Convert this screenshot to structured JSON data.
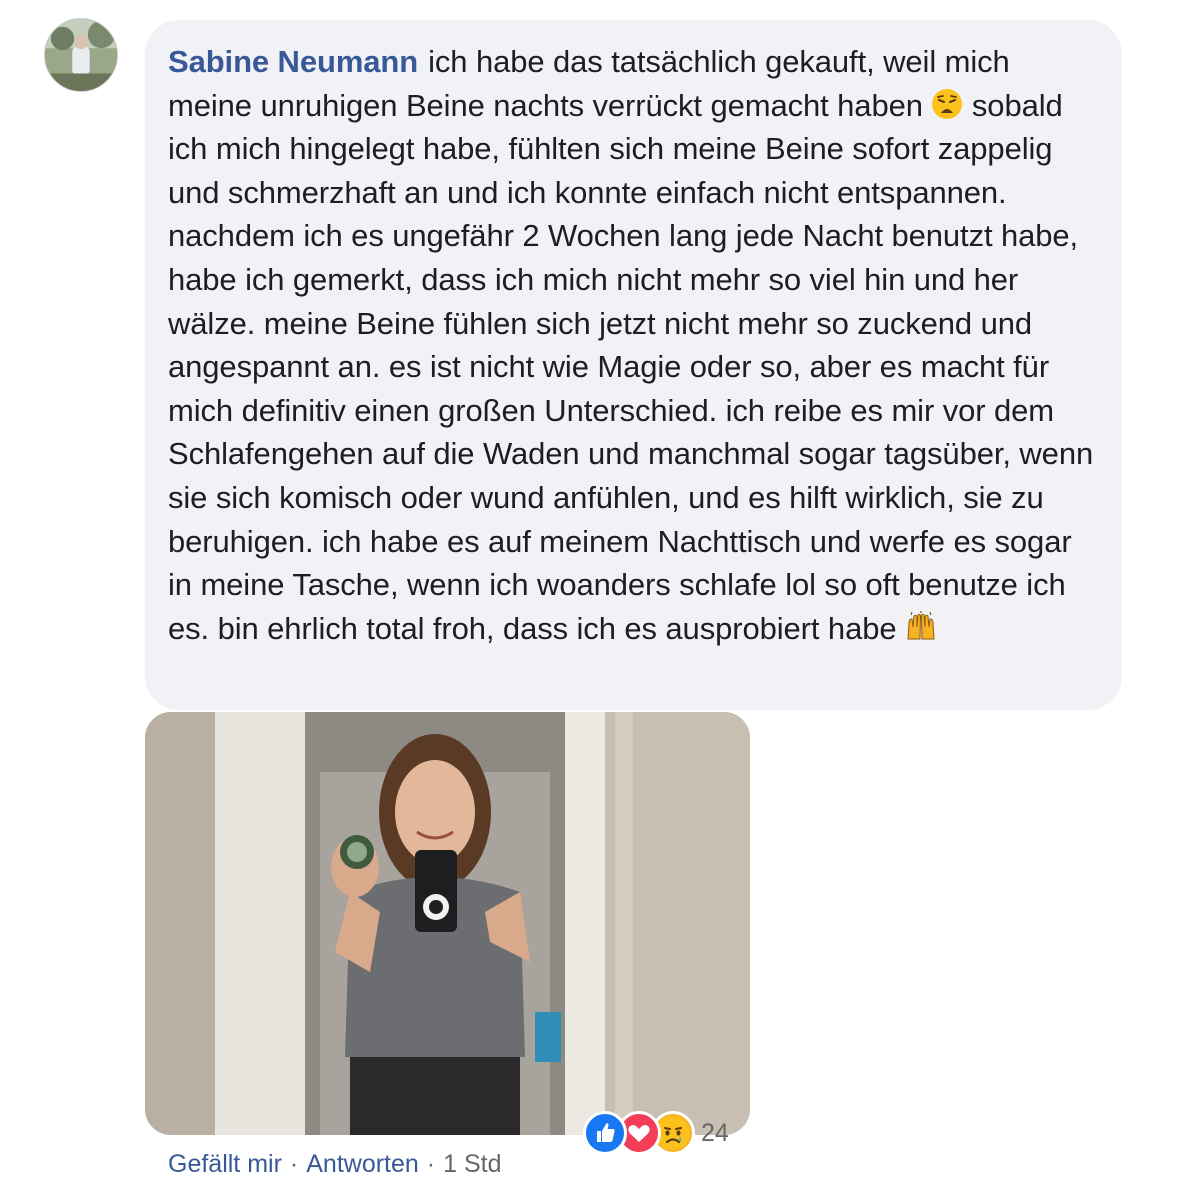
{
  "comment": {
    "author": "Sabine Neumann",
    "text_part1": "ich habe das tatsächlich gekauft, weil mich meine unruhigen Beine nachts verrückt gemacht haben",
    "emoji1": "weary-face",
    "text_part2": "sobald ich mich hingelegt habe, fühlten sich meine Beine sofort zappelig und schmerzhaft an und ich konnte einfach nicht entspannen. nachdem ich es ungefähr 2 Wochen lang jede Nacht benutzt habe, habe ich gemerkt, dass ich mich nicht mehr so viel hin und her wälze. meine Beine fühlen sich jetzt nicht mehr so zuckend und angespannt an. es ist nicht wie Magie oder so, aber es macht für mich definitiv einen großen Unterschied. ich reibe es mir vor dem Schlafengehen auf die Waden und manchmal sogar tagsüber, wenn sie sich komisch oder wund anfühlen, und es hilft wirklich, sie zu beruhigen. ich habe es auf meinem Nachttisch und werfe es sogar in meine Tasche, wenn ich woanders schlafe lol so oft benutze ich es. bin ehrlich total froh, dass ich es ausprobiert habe",
    "emoji2": "raising-hands"
  },
  "reactions": {
    "icons": [
      "like-icon",
      "love-icon",
      "sad-icon"
    ],
    "count": "24"
  },
  "actions": {
    "like": "Gefällt mir",
    "reply": "Antworten",
    "separator": "·",
    "time": "1 Std"
  },
  "colors": {
    "author": "#385898",
    "bubble": "#f0f2f5",
    "meta": "#65676b",
    "like": "#1877f2",
    "love": "#f33e58",
    "sad": "#f7b125"
  }
}
